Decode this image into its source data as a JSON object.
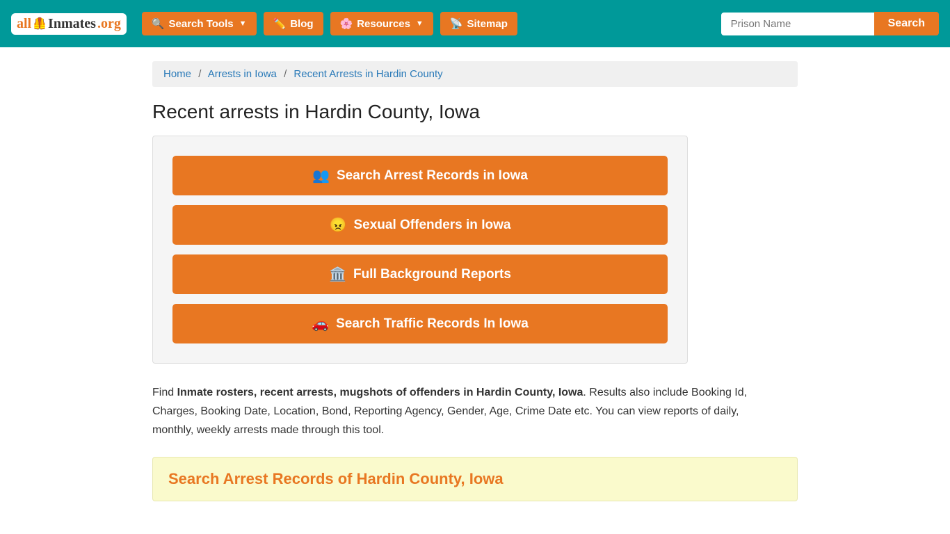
{
  "navbar": {
    "logo": {
      "all": "all",
      "inmates": "Inmates",
      "org": ".org"
    },
    "nav_items": [
      {
        "label": "Search Tools",
        "icon": "🔍",
        "has_dropdown": true
      },
      {
        "label": "Blog",
        "icon": "✏️",
        "has_dropdown": false
      },
      {
        "label": "Resources",
        "icon": "🌸",
        "has_dropdown": true
      },
      {
        "label": "Sitemap",
        "icon": "📡",
        "has_dropdown": false
      }
    ],
    "search_placeholder": "Prison Name",
    "search_button": "Search"
  },
  "breadcrumb": {
    "home": "Home",
    "arrests": "Arrests in Iowa",
    "current": "Recent Arrests in Hardin County"
  },
  "page": {
    "title": "Recent arrests in Hardin County, Iowa",
    "buttons": [
      {
        "icon": "👥",
        "label": "Search Arrest Records in Iowa"
      },
      {
        "icon": "😠",
        "label": "Sexual Offenders in Iowa"
      },
      {
        "icon": "🏛️",
        "label": "Full Background Reports"
      },
      {
        "icon": "🚗",
        "label": "Search Traffic Records In Iowa"
      }
    ],
    "description_normal_1": "Find ",
    "description_bold": "Inmate rosters, recent arrests, mugshots of offenders in Hardin County, Iowa",
    "description_normal_2": ". Results also include Booking Id, Charges, Booking Date, Location, Bond, Reporting Agency, Gender, Age, Crime Date etc. You can view reports of daily, monthly, weekly arrests made through this tool.",
    "bottom_heading": "Search Arrest Records of Hardin County, Iowa"
  }
}
